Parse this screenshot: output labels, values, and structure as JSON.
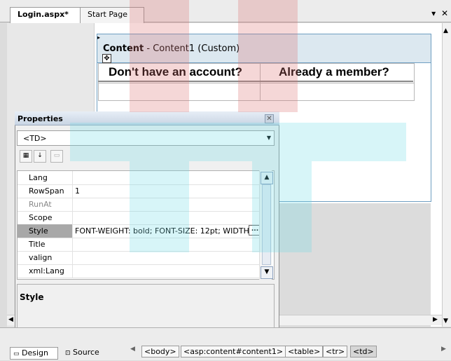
{
  "tabs": [
    {
      "label": "Login.aspx*",
      "active": true
    },
    {
      "label": "Start Page",
      "active": false
    }
  ],
  "tab_controls": {
    "dropdown": "▾",
    "close": "✕"
  },
  "content": {
    "header_bold": "Content",
    "header_rest": " - Content1 (Custom)"
  },
  "table": {
    "headers": [
      "Don't have an account?",
      "Already a member?"
    ]
  },
  "properties": {
    "title": "Properties",
    "selector_value": "<TD>",
    "rows": [
      {
        "name": "Lang",
        "value": ""
      },
      {
        "name": "RowSpan",
        "value": "1"
      },
      {
        "name": "RunAt",
        "value": "",
        "dim": true
      },
      {
        "name": "Scope",
        "value": ""
      },
      {
        "name": "Style",
        "value": "FONT-WEIGHT: bold; FONT-SIZE: 12pt; WIDTH",
        "selected": true
      },
      {
        "name": "Title",
        "value": ""
      },
      {
        "name": "valign",
        "value": ""
      },
      {
        "name": "xml:Lang",
        "value": ""
      }
    ],
    "description_title": "Style",
    "ellipsis": "..."
  },
  "bottom": {
    "views": [
      "Design",
      "Source"
    ],
    "breadcrumbs": [
      "<body>",
      "<asp:content#content1>",
      "<table>",
      "<tr>",
      "<td>"
    ]
  },
  "colors": {
    "accent": "#6f9fc2",
    "watermark_red": "#dc6e6e",
    "watermark_cyan": "#6edce6"
  }
}
